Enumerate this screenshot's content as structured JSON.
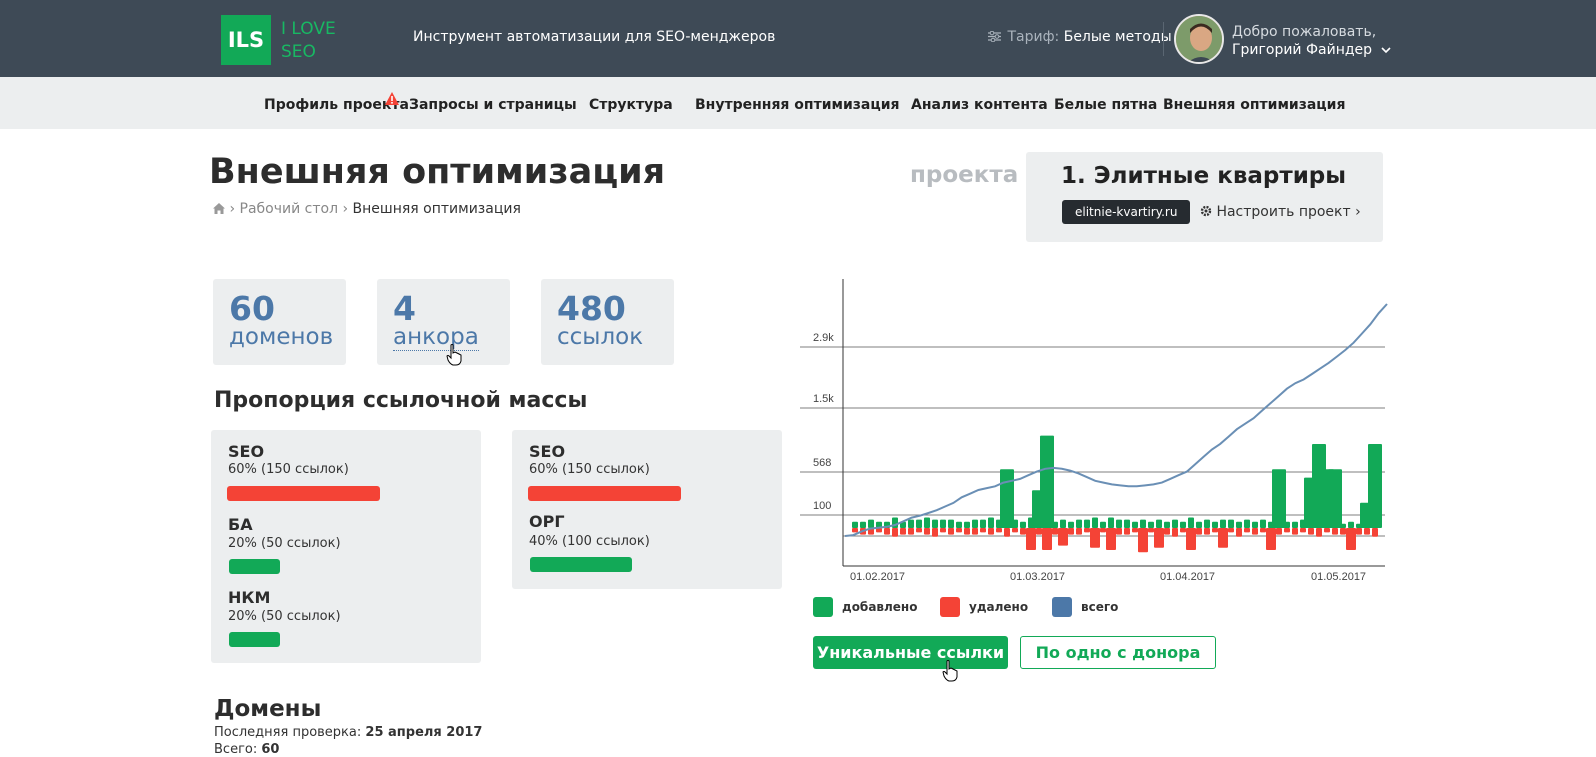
{
  "header": {
    "logo_abbr": "ILS",
    "logo_line1": "I LOVE",
    "logo_line2": "SEO",
    "tagline": "Инструмент автоматизации для SEO-менджеров",
    "tariff_label": "Тариф:",
    "tariff_value": "Белые методы",
    "welcome": "Добро пожаловать,",
    "user_name": "Григорий Файндер"
  },
  "nav": {
    "items": [
      "Профиль проекта",
      "Запросы и страницы",
      "Структура",
      "Внутренняя оптимизация",
      "Анализ контента",
      "Белые пятна",
      "Внешняя оптимизация"
    ]
  },
  "page": {
    "title": "Внешняя оптимизация",
    "breadcrumb_home": "Рабочий стол",
    "breadcrumb_current": "Внешняя оптимизация",
    "project_word": "проекта",
    "project_name": "1. Элитные квартиры",
    "project_domain": "elitnie-kvartiry.ru",
    "setup_label": "Настроить проект"
  },
  "stats": [
    {
      "value": "60",
      "label": "доменов"
    },
    {
      "value": "4",
      "label": "анкора"
    },
    {
      "value": "480",
      "label": "ссылок"
    }
  ],
  "proportion": {
    "title": "Пропорция ссылочной массы",
    "left": [
      {
        "label": "SEO",
        "sub": "60% (150 ссылок)",
        "fraction": 0.6,
        "color": "#f44336"
      },
      {
        "label": "БА",
        "sub": "20% (50 ссылок)",
        "fraction": 0.2,
        "color": "#12a957"
      },
      {
        "label": "НКМ",
        "sub": "20% (50 ссылок)",
        "fraction": 0.2,
        "color": "#12a957"
      }
    ],
    "right": [
      {
        "label": "SEO",
        "sub": "60% (150 ссылок)",
        "fraction": 0.6,
        "color": "#f44336"
      },
      {
        "label": "ОРГ",
        "sub": "40% (100 ссылок)",
        "fraction": 0.4,
        "color": "#12a957"
      }
    ]
  },
  "domains": {
    "title": "Домены",
    "last_check_label": "Последняя проверка:",
    "last_check_value": "25 апреля 2017",
    "total_label": "Всего:",
    "total_value": "60"
  },
  "chart_data": {
    "type": "bar",
    "y_ticks": [
      "2.9k",
      "1.5k",
      "568",
      "100"
    ],
    "x_ticks": [
      "01.02.2017",
      "01.03.2017",
      "01.04.2017",
      "01.05.2017"
    ],
    "legend": [
      "добавлено",
      "удалено",
      "всего"
    ],
    "colors": {
      "added": "#12a957",
      "removed": "#f44336",
      "total": "#6a8fb5"
    },
    "added": [
      3,
      3,
      4,
      3,
      3,
      5,
      3,
      4,
      4,
      5,
      4,
      4,
      4,
      3,
      3,
      4,
      4,
      5,
      4,
      28,
      4,
      3,
      5,
      18,
      44,
      3,
      4,
      3,
      4,
      4,
      5,
      3,
      5,
      4,
      4,
      3,
      4,
      3,
      4,
      3,
      4,
      3,
      5,
      3,
      4,
      3,
      4,
      4,
      3,
      4,
      3,
      4,
      3,
      28,
      3,
      3,
      4,
      24,
      40,
      28,
      28,
      2,
      3,
      2,
      12,
      40
    ],
    "removed": [
      2,
      3,
      3,
      2,
      3,
      4,
      3,
      3,
      2,
      3,
      4,
      2,
      3,
      2,
      3,
      3,
      2,
      3,
      2,
      4,
      2,
      3,
      10,
      3,
      10,
      3,
      8,
      3,
      3,
      2,
      9,
      2,
      10,
      3,
      3,
      2,
      11,
      2,
      9,
      3,
      4,
      2,
      10,
      3,
      3,
      2,
      9,
      2,
      4,
      2,
      3,
      2,
      10,
      3,
      2,
      3,
      2,
      3,
      4,
      2,
      3,
      3,
      10,
      3,
      3,
      4
    ],
    "total": [
      100,
      110,
      150,
      180,
      190,
      200,
      220,
      260,
      300,
      320,
      350,
      380,
      420,
      460,
      520,
      560,
      600,
      620,
      640,
      680,
      700,
      720,
      760,
      800,
      830,
      840,
      830,
      810,
      780,
      740,
      700,
      680,
      660,
      650,
      640,
      640,
      650,
      660,
      680,
      720,
      760,
      800,
      880,
      960,
      1040,
      1100,
      1180,
      1260,
      1320,
      1380,
      1460,
      1540,
      1620,
      1700,
      1760,
      1800,
      1860,
      1920,
      1980,
      2050,
      2120,
      2200,
      2300,
      2400,
      2520,
      2620
    ]
  },
  "buttons": {
    "unique_links": "Уникальные ссылки",
    "one_per_donor": "По одно с донора"
  }
}
